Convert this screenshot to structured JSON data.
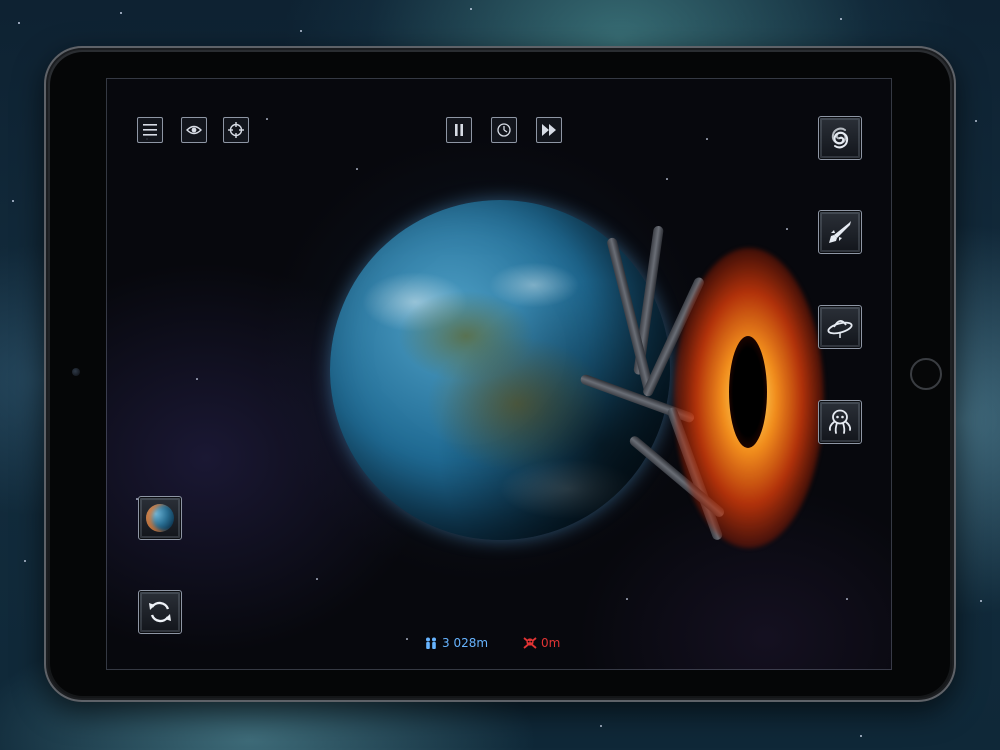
{
  "toolbar_left": {
    "menu_icon": "hamburger-menu-icon",
    "view_icon": "eye-icon",
    "target_icon": "crosshair-icon"
  },
  "toolbar_center": {
    "pause_icon": "pause-icon",
    "time_icon": "clock-icon",
    "fast_forward_icon": "fast-forward-icon"
  },
  "weapons": [
    {
      "name": "black-hole",
      "icon": "spiral-galaxy-icon"
    },
    {
      "name": "missile",
      "icon": "missile-icon"
    },
    {
      "name": "ufo",
      "icon": "ufo-icon"
    },
    {
      "name": "monster",
      "icon": "octopus-icon"
    }
  ],
  "side_left": {
    "planet_select_icon": "planet-thumbnail-icon",
    "reset_icon": "refresh-icon"
  },
  "status": {
    "population": "3 028m",
    "deaths": "0m"
  },
  "colors": {
    "population": "#67b4ff",
    "deaths": "#e13434",
    "button_border": "#8e96a4"
  }
}
